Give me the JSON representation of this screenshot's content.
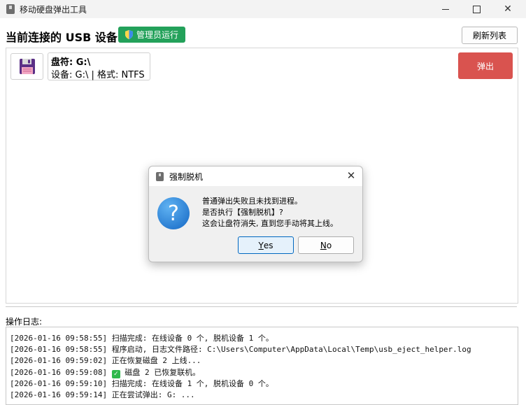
{
  "window": {
    "title": "移动硬盘弹出工具",
    "icons": {
      "app": "app-icon",
      "minimize": "minimize-icon",
      "maximize": "maximize-icon",
      "close": "close-icon"
    }
  },
  "header": {
    "title": "当前连接的 USB 设备",
    "admin_badge": "管理员运行",
    "refresh_button": "刷新列表"
  },
  "device": {
    "drive_label": "盘符: G:\\",
    "detail": "设备: G:\\ | 格式: NTFS",
    "eject_button": "弹出",
    "icon": "floppy-disk-icon"
  },
  "log": {
    "label": "操作日志:",
    "lines": [
      "[2026-01-16 09:58:55] 扫描完成: 在线设备 0 个, 脱机设备 1 个。",
      "[2026-01-16 09:58:55] 程序启动, 日志文件路径: C:\\Users\\Computer\\AppData\\Local\\Temp\\usb_eject_helper.log",
      "[2026-01-16 09:59:02] 正在恢复磁盘 2 上线...",
      "磁盘 2 已恢复联机。",
      "[2026-01-16 09:59:10] 扫描完成: 在线设备 1 个, 脱机设备 0 个。",
      "[2026-01-16 09:59:14] 正在尝试弹出: G: ..."
    ],
    "line4_timestamp": "[2026-01-16 09:59:08]"
  },
  "dialog": {
    "title": "强制脱机",
    "message_lines": [
      "普通弹出失败且未找到进程。",
      "是否执行【强制脱机】?",
      "这会让盘符消失, 直到您手动将其上线。"
    ],
    "yes_prefix": "",
    "yes_mnemonic": "Y",
    "yes_rest": "es",
    "no_mnemonic": "N",
    "no_rest": "o"
  },
  "colors": {
    "admin_badge": "#23a15a",
    "eject_button": "#d9534f",
    "question_icon": "#1467c4"
  }
}
